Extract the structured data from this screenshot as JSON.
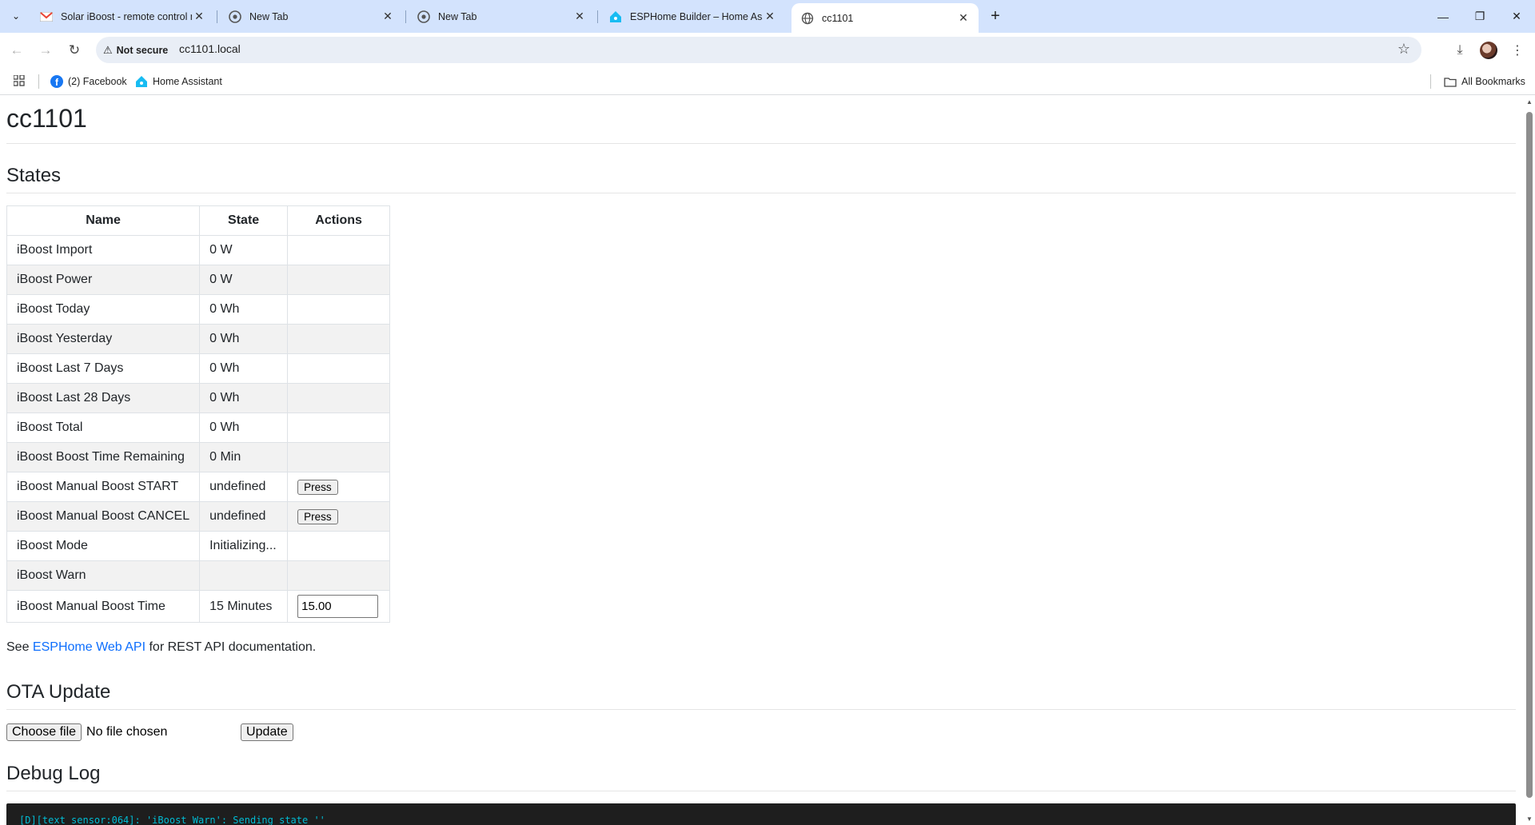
{
  "browser": {
    "tabs": [
      {
        "title": "Solar iBoost - remote control n",
        "favicon": "gmail-favicon"
      },
      {
        "title": "New Tab",
        "favicon": "chrome-favicon"
      },
      {
        "title": "New Tab",
        "favicon": "chrome-favicon"
      },
      {
        "title": "ESPHome Builder – Home Assis",
        "favicon": "home-assistant-favicon"
      },
      {
        "title": "cc1101",
        "favicon": "globe-favicon",
        "active": true
      }
    ],
    "security_label": "Not secure",
    "url": "cc1101.local",
    "bookmarks": [
      {
        "label": "(2) Facebook",
        "icon": "facebook-icon"
      },
      {
        "label": "Home Assistant",
        "icon": "home-assistant-icon"
      }
    ],
    "all_bookmarks_label": "All Bookmarks"
  },
  "page": {
    "title": "cc1101",
    "states_heading": "States",
    "table": {
      "headers": [
        "Name",
        "State",
        "Actions"
      ],
      "rows": [
        {
          "name": "iBoost Import",
          "state": "0 W"
        },
        {
          "name": "iBoost Power",
          "state": "0 W"
        },
        {
          "name": "iBoost Today",
          "state": "0 Wh"
        },
        {
          "name": "iBoost Yesterday",
          "state": "0 Wh"
        },
        {
          "name": "iBoost Last 7 Days",
          "state": "0 Wh"
        },
        {
          "name": "iBoost Last 28 Days",
          "state": "0 Wh"
        },
        {
          "name": "iBoost Total",
          "state": "0 Wh"
        },
        {
          "name": "iBoost Boost Time Remaining",
          "state": "0 Min"
        },
        {
          "name": "iBoost Manual Boost START",
          "state": "undefined",
          "action": "Press"
        },
        {
          "name": "iBoost Manual Boost CANCEL",
          "state": "undefined",
          "action": "Press"
        },
        {
          "name": "iBoost Mode",
          "state": "Initializing..."
        },
        {
          "name": "iBoost Warn",
          "state": ""
        },
        {
          "name": "iBoost Manual Boost Time",
          "state": "15 Minutes",
          "input_value": "15.00"
        }
      ]
    },
    "api_note": {
      "prefix": "See ",
      "link": "ESPHome Web API",
      "suffix": " for REST API documentation."
    },
    "ota": {
      "heading": "OTA Update",
      "choose_file": "Choose file",
      "no_file": "No file chosen",
      "update_button": "Update"
    },
    "debug": {
      "heading": "Debug Log",
      "first_line": "[D][text_sensor:064]: 'iBoost Warn': Sending state ''"
    }
  }
}
